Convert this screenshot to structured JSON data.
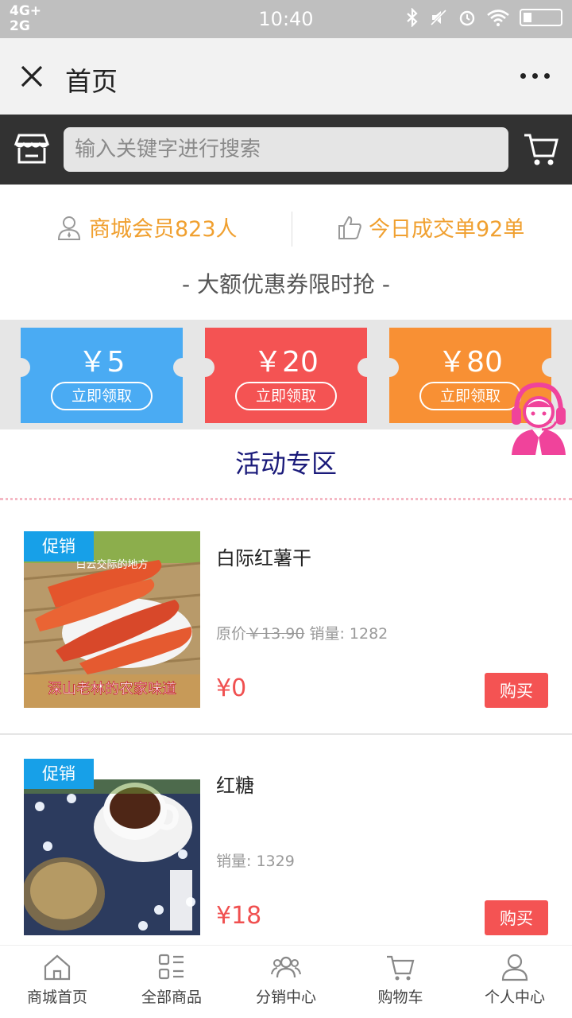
{
  "status_bar": {
    "network_line1": "4G+",
    "network_line2": "2G",
    "time": "10:40",
    "icons": [
      "bluetooth-icon",
      "mute-icon",
      "alarm-icon",
      "wifi-icon",
      "battery-icon"
    ]
  },
  "title_bar": {
    "title": "首页",
    "close_icon": "close-icon",
    "more_icon": "more-icon"
  },
  "search": {
    "placeholder": "输入关键字进行搜索",
    "store_icon": "store-icon",
    "cart_icon": "cart-icon"
  },
  "stats": {
    "members": "商城会员823人",
    "orders_today": "今日成交单92单",
    "colors": {
      "accent": "#f0a030"
    }
  },
  "coupons": {
    "heading": "- 大额优惠券限时抢 -",
    "items": [
      {
        "amount": "￥5",
        "button": "立即领取",
        "color": "#4aabf3"
      },
      {
        "amount": "￥20",
        "button": "立即领取",
        "color": "#f45353"
      },
      {
        "amount": "￥80",
        "button": "立即领取",
        "color": "#f89034"
      }
    ]
  },
  "activity": {
    "title": "活动专区"
  },
  "products": [
    {
      "badge": "促销",
      "name": "白际红薯干",
      "original_label": "原价",
      "original_price": "￥13.90",
      "sales": "销量: 1282",
      "price": "¥0",
      "buy_label": "购买",
      "image_caption_top": "白云交际的地方",
      "image_caption_bottom": "深山老林的农家味道"
    },
    {
      "badge": "促销",
      "name": "红糖",
      "sales": "销量: 1329",
      "price": "¥18",
      "buy_label": "购买"
    }
  ],
  "bottom_nav": [
    {
      "label": "商城首页",
      "icon": "home-icon"
    },
    {
      "label": "全部商品",
      "icon": "grid-list-icon"
    },
    {
      "label": "分销中心",
      "icon": "users-icon"
    },
    {
      "label": "购物车",
      "icon": "cart-icon"
    },
    {
      "label": "个人中心",
      "icon": "person-icon"
    }
  ],
  "theme": {
    "price_red": "#f05050",
    "promo_blue": "#17a0e8",
    "header_dark": "#323232"
  }
}
